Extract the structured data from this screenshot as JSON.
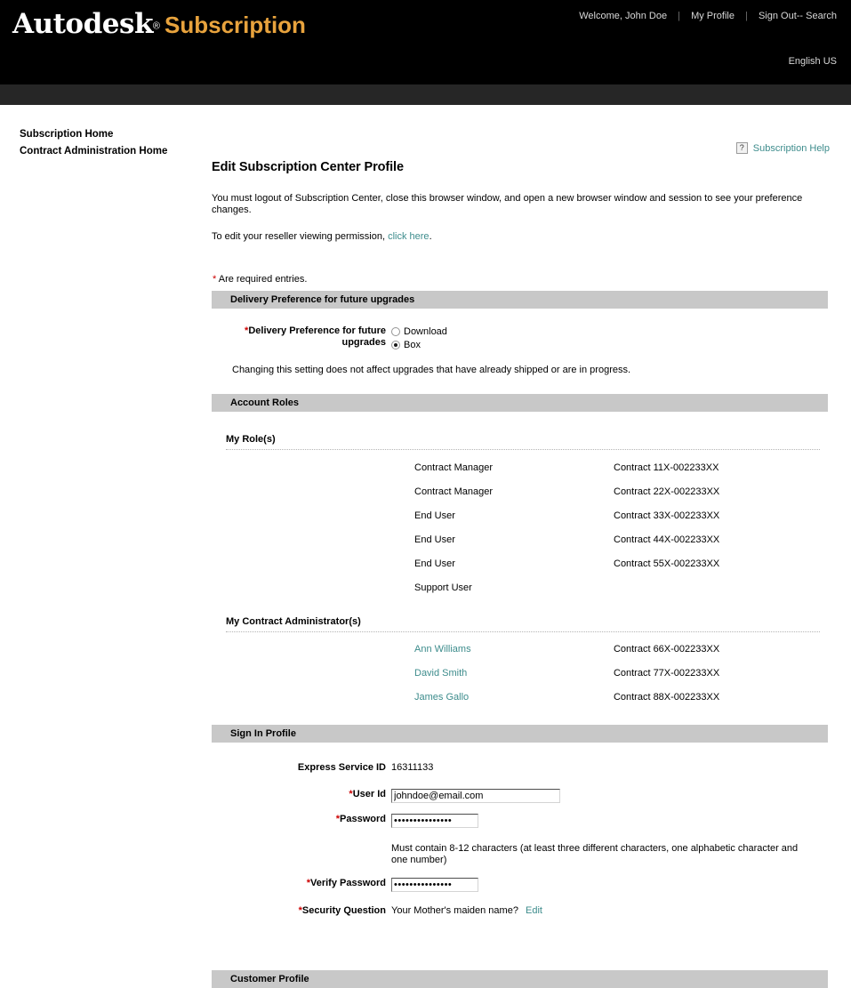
{
  "header": {
    "brand_primary": "Autodesk",
    "brand_reg": "®",
    "brand_secondary": "Subscription",
    "welcome": "Welcome, John Doe",
    "my_profile": "My Profile",
    "sign_out_search": "Sign Out-- Search",
    "separator": "|",
    "language": "English US"
  },
  "leftnav": {
    "items": [
      {
        "label": "Subscription Home"
      },
      {
        "label": "Contract Administration Home"
      }
    ]
  },
  "help": {
    "icon_text": "?",
    "label": "Subscription Help"
  },
  "main": {
    "title": "Edit Subscription Center Profile",
    "intro": "You must logout of Subscription Center, close this browser window, and open a new browser window and session to see your preference changes.",
    "intro2_prefix": "To edit your reseller viewing permission, ",
    "intro2_link": "click here",
    "intro2_suffix": ".",
    "required_note": "Are required entries.",
    "required_star": "*"
  },
  "delivery": {
    "section_title": "Delivery Preference for future upgrades",
    "field_label": "Delivery Preference for future upgrades",
    "options": [
      {
        "label": "Download",
        "selected": false
      },
      {
        "label": "Box",
        "selected": true
      }
    ],
    "note": "Changing this setting does not affect upgrades that have already shipped or are in progress."
  },
  "account_roles": {
    "section_title": "Account Roles",
    "my_roles_title": "My Role(s)",
    "roles": [
      {
        "role": "Contract Manager",
        "contract": "Contract 11X-002233XX"
      },
      {
        "role": "Contract Manager",
        "contract": "Contract 22X-002233XX"
      },
      {
        "role": "End User",
        "contract": "Contract 33X-002233XX"
      },
      {
        "role": "End User",
        "contract": "Contract 44X-002233XX"
      },
      {
        "role": "End User",
        "contract": "Contract 55X-002233XX"
      },
      {
        "role": "Support User",
        "contract": ""
      }
    ],
    "admins_title": "My Contract Administrator(s)",
    "admins": [
      {
        "name": "Ann Williams",
        "contract": "Contract 66X-002233XX"
      },
      {
        "name": "David Smith",
        "contract": "Contract 77X-002233XX"
      },
      {
        "name": "James Gallo",
        "contract": "Contract 88X-002233XX"
      }
    ]
  },
  "signin": {
    "section_title": "Sign In Profile",
    "express_label": "Express Service ID",
    "express_value": "16311133",
    "userid_label": "User Id",
    "userid_value": "johndoe@email.com",
    "password_label": "Password",
    "password_value": "•••••••••••••••",
    "password_hint": "Must contain 8-12 characters (at least three different characters, one alphabetic character and one number)",
    "verify_label": "Verify Password",
    "verify_value": "•••••••••••••••",
    "security_label": "Security Question",
    "security_value": "Your Mother's maiden name?",
    "security_edit": "Edit"
  },
  "customer": {
    "section_title": "Customer Profile"
  },
  "colors": {
    "header_bg": "#000000",
    "subbar_bg": "#262626",
    "brand_accent": "#e8a33d",
    "link_teal": "#3d8c8c",
    "required_red": "#cc0000",
    "section_bar": "#c8c8c8"
  }
}
